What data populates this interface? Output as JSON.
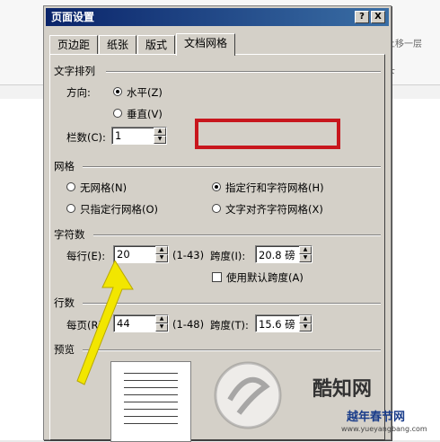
{
  "dialog": {
    "title": "页面设置",
    "help_button": "?",
    "close_button": "X",
    "tabs": [
      "页边距",
      "纸张",
      "版式",
      "文档网格"
    ],
    "active_tab": "文档网格"
  },
  "text_direction": {
    "section_label": "文字排列",
    "direction_label": "方向:",
    "horizontal": "水平(Z)",
    "vertical": "垂直(V)",
    "selected": "水平(Z)",
    "columns_label": "栏数(C):",
    "columns_value": "1"
  },
  "grid": {
    "section_label": "网格",
    "options": [
      "无网格(N)",
      "指定行和字符网格(H)",
      "只指定行网格(O)",
      "文字对齐字符网格(X)"
    ],
    "selected": "指定行和字符网格(H)"
  },
  "characters": {
    "section_label": "字符数",
    "per_line_label": "每行(E):",
    "per_line_value": "20",
    "per_line_range": "(1-43)",
    "pitch_label": "跨度(I):",
    "pitch_value": "20.8 磅",
    "default_pitch_label": "使用默认跨度(A)"
  },
  "lines": {
    "section_label": "行数",
    "per_page_label": "每页(R):",
    "per_page_value": "44",
    "per_page_range": "(1-48)",
    "pitch_label": "跨度(T):",
    "pitch_value": "15.6 磅"
  },
  "preview": {
    "section_label": "预览"
  },
  "background": {
    "right_ribbon_text": "上移一层",
    "right_ribbon_text2": "下"
  },
  "watermark": {
    "brand": "酷知网",
    "sub": "越年春节网",
    "url": "www.yueyangbang.com"
  },
  "colors": {
    "highlight": "#c8161d",
    "arrow": "#f2e600",
    "titlebar": "#0a246a"
  }
}
